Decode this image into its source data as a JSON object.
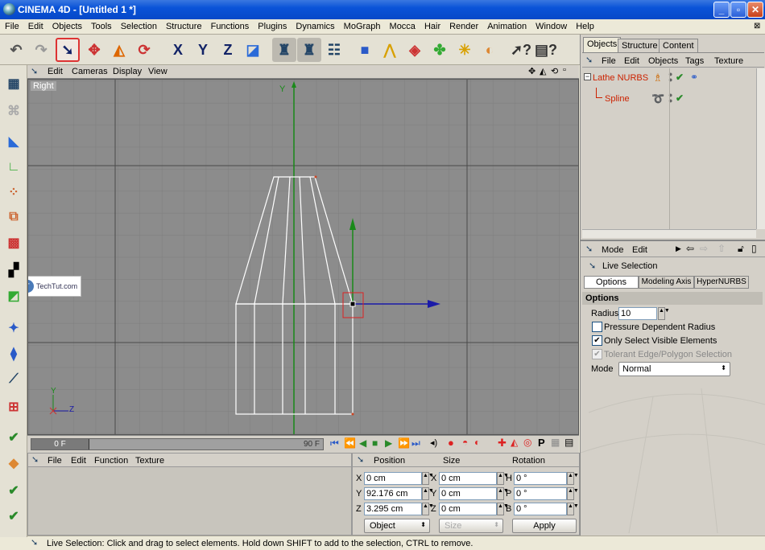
{
  "window": {
    "title": "CINEMA 4D - [Untitled 1 *]",
    "min": "_",
    "max": "▫",
    "close": "✕"
  },
  "menubar": [
    "File",
    "Edit",
    "Objects",
    "Tools",
    "Selection",
    "Structure",
    "Functions",
    "Plugins",
    "Dynamics",
    "MoGraph",
    "Mocca",
    "Hair",
    "Render",
    "Animation",
    "Window",
    "Help"
  ],
  "viewport": {
    "menu": [
      "Edit",
      "Cameras",
      "Display",
      "View"
    ],
    "label": "Right",
    "axis_y": "Y",
    "mini_y": "Y",
    "mini_z": "Z",
    "watermark": "TechTut.com"
  },
  "timeline": {
    "current": "0 F",
    "end": "90 F"
  },
  "material_manager": {
    "menu": [
      "File",
      "Edit",
      "Function",
      "Texture"
    ]
  },
  "coordinates": {
    "headers": [
      "Position",
      "Size",
      "Rotation"
    ],
    "rows": [
      {
        "axis": "X",
        "pos": "0 cm",
        "size_axis": "X",
        "size": "0 cm",
        "rot_axis": "H",
        "rot": "0 °"
      },
      {
        "axis": "Y",
        "pos": "92.176 cm",
        "size_axis": "Y",
        "size": "0 cm",
        "rot_axis": "P",
        "rot": "0 °"
      },
      {
        "axis": "Z",
        "pos": "3.295 cm",
        "size_axis": "Z",
        "size": "0 cm",
        "rot_axis": "B",
        "rot": "0 °"
      }
    ],
    "mode": "Object",
    "size_mode": "Size",
    "apply": "Apply"
  },
  "object_manager": {
    "tabs": [
      "Objects",
      "Structure",
      "Content"
    ],
    "menu": [
      "File",
      "Edit",
      "Objects",
      "Tags",
      "Texture"
    ],
    "items": [
      {
        "name": "Lathe NURBS",
        "toggle": "−"
      },
      {
        "name": "Spline"
      }
    ]
  },
  "attribute_manager": {
    "menu": [
      "Mode",
      "Edit"
    ],
    "tool": "Live Selection",
    "tabs": [
      "Options",
      "Modeling Axis",
      "HyperNURBS"
    ],
    "section": "Options",
    "radius_label": "Radius",
    "radius": "10",
    "pressure": "Pressure Dependent Radius",
    "only_visible": "Only Select Visible Elements",
    "tolerant": "Tolerant Edge/Polygon Selection",
    "mode_label": "Mode",
    "mode_value": "Normal"
  },
  "status": "Live Selection: Click and drag to select elements. Hold down SHIFT to add to the selection, CTRL to remove.",
  "colors": {
    "viewport_bg": "#8c8c8c",
    "grid": "#7a7a7a",
    "axis_y": "#1a8a1a",
    "axis_z": "#1a1aa8",
    "object_name": "#cc2200",
    "selection": "#dd2222"
  }
}
